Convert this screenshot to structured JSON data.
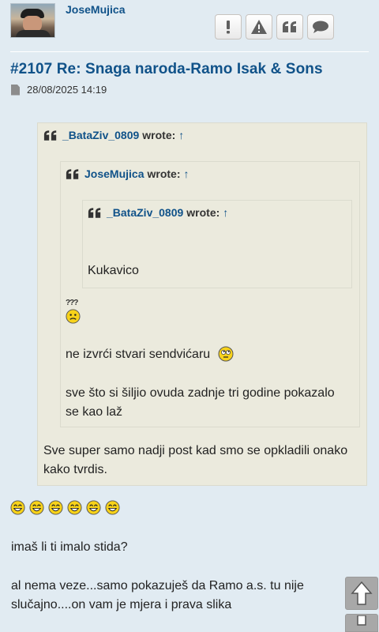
{
  "author": {
    "username": "JoseMujica",
    "avatar": "avatar-photo-man-with-cap"
  },
  "actions": [
    {
      "name": "report-button",
      "icon": "exclamation-icon"
    },
    {
      "name": "warn-button",
      "icon": "warning-triangle-icon"
    },
    {
      "name": "quote-button",
      "icon": "quote-icon"
    },
    {
      "name": "reply-button",
      "icon": "speech-bubble-icon"
    }
  ],
  "post": {
    "title": "#2107 Re: Snaga naroda-Ramo Isak & Sons",
    "date": "28/08/2025 14:19"
  },
  "quotes": {
    "outer": {
      "author": "_BataZiv_0809",
      "wrote": "wrote:",
      "arrow": "↑",
      "text": "Sve super samo nadji post kad smo se opkladili onako kako tvrdis."
    },
    "middle": {
      "author": "JoseMujica",
      "wrote": "wrote:",
      "arrow": "↑",
      "text1": "ne izvrći stvari sendvićaru",
      "text2": "sve što si šiljio ovuda zadnje tri godine pokazalo se kao laž"
    },
    "inner": {
      "author": "_BataZiv_0809",
      "wrote": "wrote:",
      "arrow": "↑",
      "text": "Kukavico"
    }
  },
  "body": {
    "line1": "imaš li ti imalo stida?",
    "line2a": "al nema veze...samo pokazuješ da Ramo a.s. tu nije",
    "line2b": "slučajno....on vam je mjera i prava slika"
  },
  "outer_text_lines": [
    "Sve super samo nadji post kad smo se opkladili onako",
    "kako tvrdis."
  ],
  "middle_text2_lines": [
    "sve što si šiljio ovuda zadnje tri godine pokazalo",
    "se kao laž"
  ],
  "smilies": {
    "confused": "???",
    "laughing_count": 6
  },
  "colors": {
    "background": "#e1ebf2",
    "link": "#105289",
    "quote_bg": "#ebeadd"
  },
  "nav": {
    "up": "scroll-up-icon",
    "down": "scroll-down-icon"
  }
}
